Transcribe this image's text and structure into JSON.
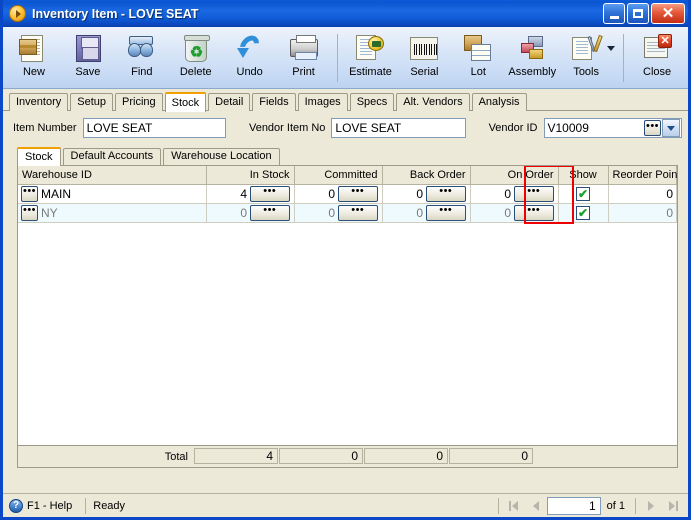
{
  "window": {
    "title": "Inventory Item",
    "title_separator": " - ",
    "subtitle": "LOVE SEAT",
    "icon": "orange-play-circle-icon",
    "minimize_label": "",
    "maximize_label": "",
    "close_label": "✕"
  },
  "toolbar": {
    "items": [
      {
        "label": "New",
        "icon": "new-document-icon"
      },
      {
        "label": "Save",
        "icon": "floppy-disk-icon"
      },
      {
        "label": "Find",
        "icon": "binoculars-icon"
      },
      {
        "label": "Delete",
        "icon": "recycle-bin-icon"
      },
      {
        "label": "Undo",
        "icon": "undo-arrow-icon"
      },
      {
        "label": "Print",
        "icon": "printer-icon"
      },
      {
        "label": "Estimate",
        "icon": "estimate-tag-icon"
      },
      {
        "label": "Serial",
        "icon": "barcode-icon"
      },
      {
        "label": "Lot",
        "icon": "lot-box-grid-icon"
      },
      {
        "label": "Assembly",
        "icon": "assembly-blocks-icon"
      },
      {
        "label": "Tools",
        "icon": "tools-wrench-icon"
      },
      {
        "label": "Close",
        "icon": "close-window-icon"
      }
    ]
  },
  "tabs": {
    "items": [
      {
        "label": "Inventory",
        "active": false
      },
      {
        "label": "Setup",
        "active": false
      },
      {
        "label": "Pricing",
        "active": false
      },
      {
        "label": "Stock",
        "active": true
      },
      {
        "label": "Detail",
        "active": false
      },
      {
        "label": "Fields",
        "active": false
      },
      {
        "label": "Images",
        "active": false
      },
      {
        "label": "Specs",
        "active": false
      },
      {
        "label": "Alt. Vendors",
        "active": false
      },
      {
        "label": "Analysis",
        "active": false
      }
    ]
  },
  "form": {
    "item_number_label": "Item Number",
    "item_number_value": "LOVE SEAT",
    "vendor_item_no_label": "Vendor Item No",
    "vendor_item_no_value": "LOVE SEAT",
    "vendor_id_label": "Vendor ID",
    "vendor_id_value": "V10009",
    "ellipsis_label": "•••"
  },
  "inner_tabs": {
    "items": [
      {
        "label": "Stock",
        "active": true
      },
      {
        "label": "Default Accounts",
        "active": false
      },
      {
        "label": "Warehouse Location",
        "active": false
      }
    ]
  },
  "grid": {
    "columns": [
      "Warehouse ID",
      "In Stock",
      "Committed",
      "Back Order",
      "On Order",
      "Show",
      "Reorder Point"
    ],
    "rows": [
      {
        "warehouse_id": "MAIN",
        "in_stock": "4",
        "committed": "0",
        "back_order": "0",
        "on_order": "0",
        "show": true,
        "reorder_point": "0",
        "selected": false
      },
      {
        "warehouse_id": "NY",
        "in_stock": "0",
        "committed": "0",
        "back_order": "0",
        "on_order": "0",
        "show": true,
        "reorder_point": "0",
        "selected": true
      }
    ],
    "checkmark": "✔",
    "cell_button_label": "•••",
    "highlight_color": "#ee0000",
    "highlighted_column": "Show"
  },
  "totals": {
    "label": "Total",
    "in_stock": "4",
    "committed": "0",
    "back_order": "0",
    "on_order": "0"
  },
  "statusbar": {
    "help_icon": "question-mark-icon",
    "help_label": "F1 - Help",
    "status_text": "Ready",
    "page_value": "1",
    "of_label": "of",
    "page_total": "1",
    "first_icon": "first-record-icon",
    "prev_icon": "previous-record-icon",
    "next_icon": "next-record-icon",
    "last_icon": "last-record-icon"
  }
}
